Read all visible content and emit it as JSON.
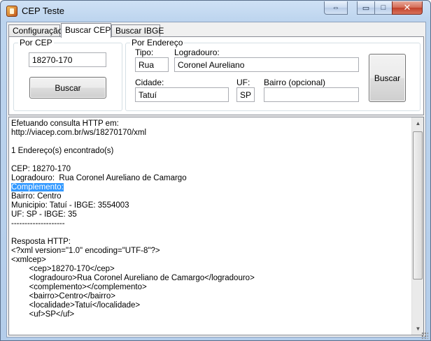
{
  "window": {
    "title": "CEP Teste",
    "controls": {
      "swap": "⇔",
      "minimize": "▭",
      "maximize": "□",
      "close": "✕"
    }
  },
  "tabs": [
    {
      "label": "Configuração",
      "active": false
    },
    {
      "label": "Buscar CEP",
      "active": true
    },
    {
      "label": "Buscar IBGE",
      "active": false
    }
  ],
  "por_cep": {
    "group_label": "Por CEP",
    "cep_value": "18270-170",
    "search_label": "Buscar"
  },
  "por_endereco": {
    "group_label": "Por Endereço",
    "tipo_label": "Tipo:",
    "tipo_value": "Rua",
    "logradouro_label": "Logradouro:",
    "logradouro_value": "Coronel Aureliano",
    "cidade_label": "Cidade:",
    "cidade_value": "Tatuí",
    "uf_label": "UF:",
    "uf_value": "SP",
    "bairro_label": "Bairro (opcional)",
    "bairro_value": "",
    "search_label": "Buscar"
  },
  "output": {
    "lines_before_selection": "Efetuando consulta HTTP em:\nhttp://viacep.com.br/ws/18270170/xml\n\n1 Endereço(s) encontrado(s)\n\nCEP: 18270-170\nLogradouro:  Rua Coronel Aureliano de Camargo\n",
    "selected_line": "Complemento:",
    "lines_after_selection": "\nBairro: Centro\nMunicipio: Tatuí - IBGE: 3554003\nUF: SP - IBGE: 35\n--------------------\n\nResposta HTTP:\n<?xml version=\"1.0\" encoding=\"UTF-8\"?>\n<xmlcep>\n\t<cep>18270-170</cep>\n\t<logradouro>Rua Coronel Aureliano de Camargo</logradouro>\n\t<complemento></complemento>\n\t<bairro>Centro</bairro>\n\t<localidade>Tatuí</localidade>\n\t<uf>SP</uf>"
  },
  "colors": {
    "selection": "#3399ff",
    "window_frame": "#b4cdea",
    "close_button": "#c2412a"
  }
}
